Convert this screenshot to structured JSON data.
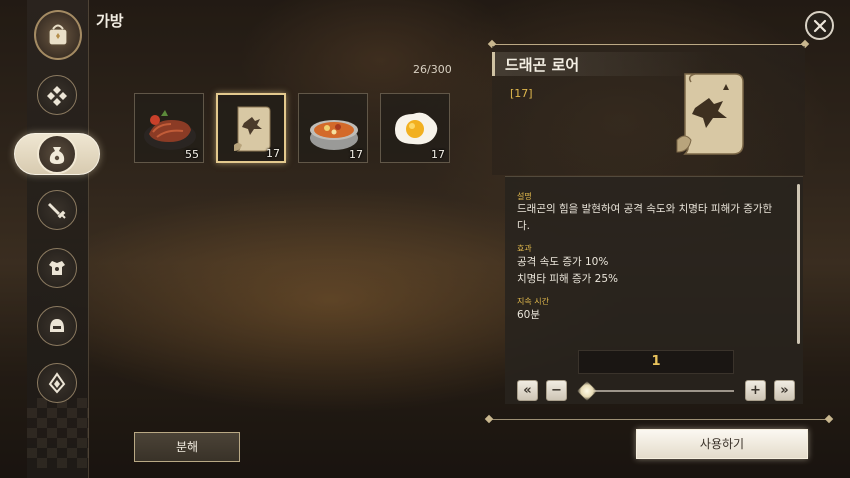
{
  "header": {
    "title": "가방",
    "inventory_count": "26/300"
  },
  "sidebar": {
    "items": [
      {
        "icon": "bag-emblem-icon"
      },
      {
        "icon": "diamond-cluster-icon"
      },
      {
        "icon": "potion-pouch-icon",
        "active": true
      },
      {
        "icon": "sword-icon"
      },
      {
        "icon": "armor-icon"
      },
      {
        "icon": "helmet-icon"
      },
      {
        "icon": "crystal-icon"
      }
    ]
  },
  "inventory": {
    "slots": [
      {
        "icon": "steak-icon",
        "qty": "55"
      },
      {
        "icon": "scroll-icon",
        "qty": "17",
        "selected": true
      },
      {
        "icon": "stew-bowl-icon",
        "qty": "17"
      },
      {
        "icon": "fried-egg-icon",
        "qty": "17"
      }
    ]
  },
  "detail": {
    "name": "드래곤 로어",
    "level": "[17]",
    "desc_label": "설명",
    "desc_line1": "드래곤의 힘을 발현하여 공격 속도와 치명타 피해가 증가한",
    "desc_line2": "다.",
    "effect_label": "효과",
    "effect_line1": "공격 속도 증가 10%",
    "effect_line2": "치명타 피해 증가 25%",
    "duration_label": "지속 시간",
    "duration_value": "60분",
    "quantity": "1",
    "quantity_slider_fraction": 0.0
  },
  "buttons": {
    "dismantle": "분해",
    "use": "사용하기",
    "min": "«",
    "minus": "−",
    "plus": "+",
    "max": "»"
  },
  "colors": {
    "accent_gold": "#e0b84d",
    "selected_border": "#e3c98e"
  }
}
